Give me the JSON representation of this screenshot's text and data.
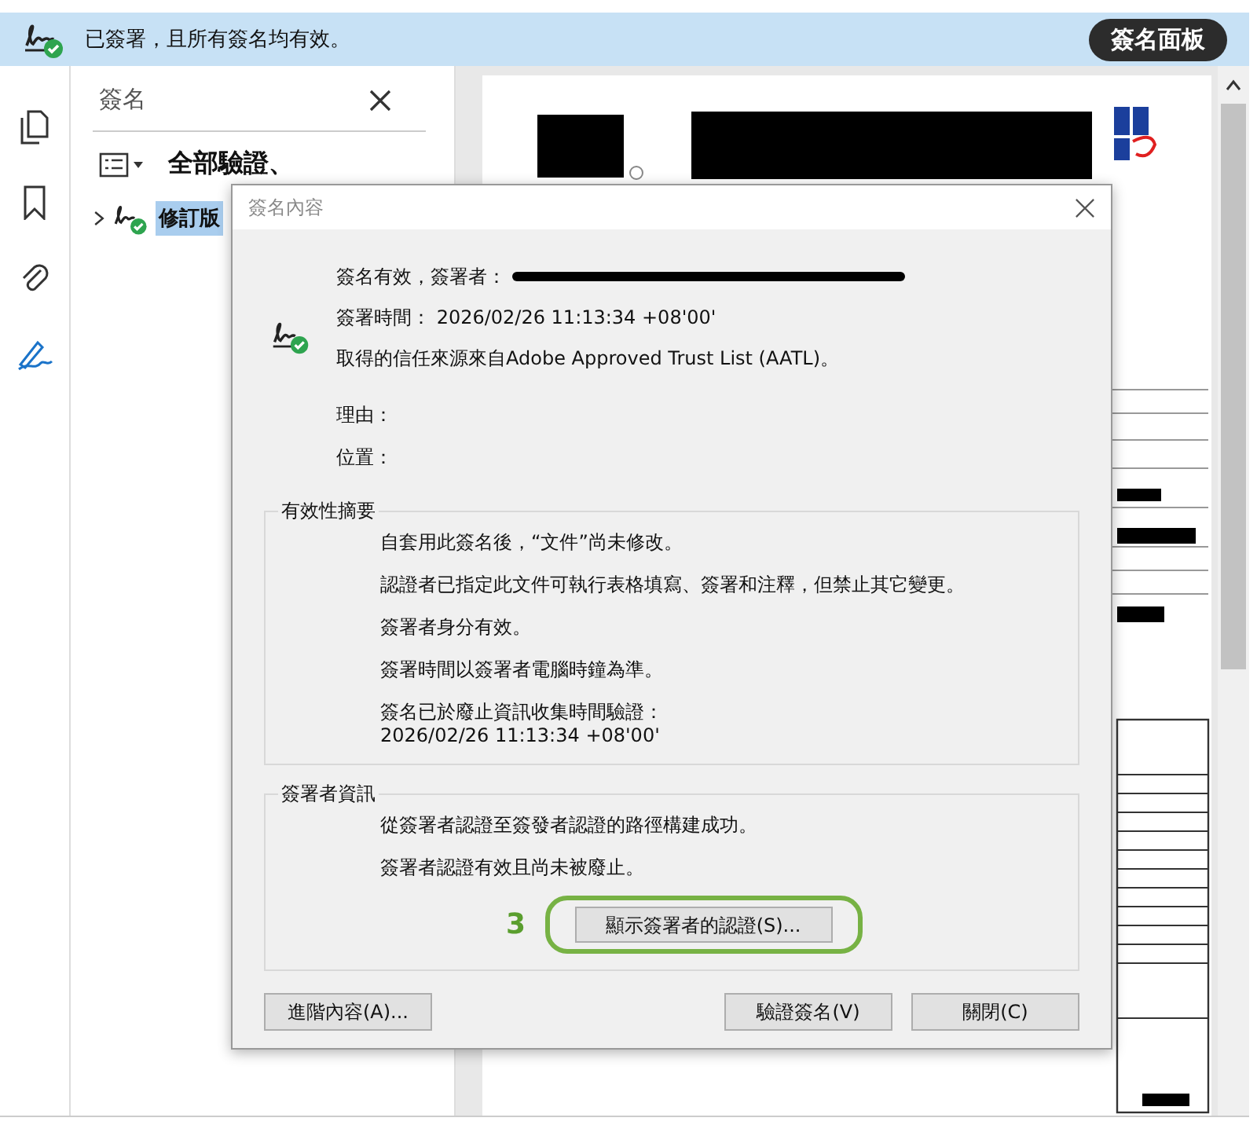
{
  "banner": {
    "message": "已簽署，且所有簽名均有效。",
    "button": "簽名面板"
  },
  "sidebar": {
    "title": "簽名",
    "toolbar_label": "全部驗證、",
    "items": [
      {
        "label": "修訂版",
        "selected": true,
        "expanded": false
      }
    ]
  },
  "dialog": {
    "title": "簽名內容",
    "lines": [
      {
        "kind": "redacted",
        "text": "簽名有效，簽署者："
      },
      {
        "kind": "plain",
        "text": "簽署時間：  2026/02/26 11:13:34 +08'00'"
      },
      {
        "kind": "plain",
        "text": "取得的信任來源來自Adobe Approved Trust List (AATL)。"
      }
    ],
    "fields": [
      "理由：",
      "位置："
    ],
    "summary": {
      "title": "有效性摘要",
      "items": [
        "自套用此簽名後，“文件”尚未修改。",
        "認證者已指定此文件可執行表格填寫、簽署和注釋，但禁止其它變更。",
        "簽署者身分有效。",
        "簽署時間以簽署者電腦時鐘為準。",
        "簽名已於廢止資訊收集時間驗證：\n2026/02/26 11:13:34 +08'00'"
      ]
    },
    "signer": {
      "title": "簽署者資訊",
      "items": [
        "從簽署者認證至簽發者認證的路徑構建成功。",
        "簽署者認證有效且尚未被廢止。"
      ],
      "button": "顯示簽署者的認證(S)...",
      "step": "3"
    },
    "footer": {
      "left": "進階內容(A)...",
      "right": [
        "驗證簽名(V)",
        "關閉(C)"
      ]
    }
  }
}
